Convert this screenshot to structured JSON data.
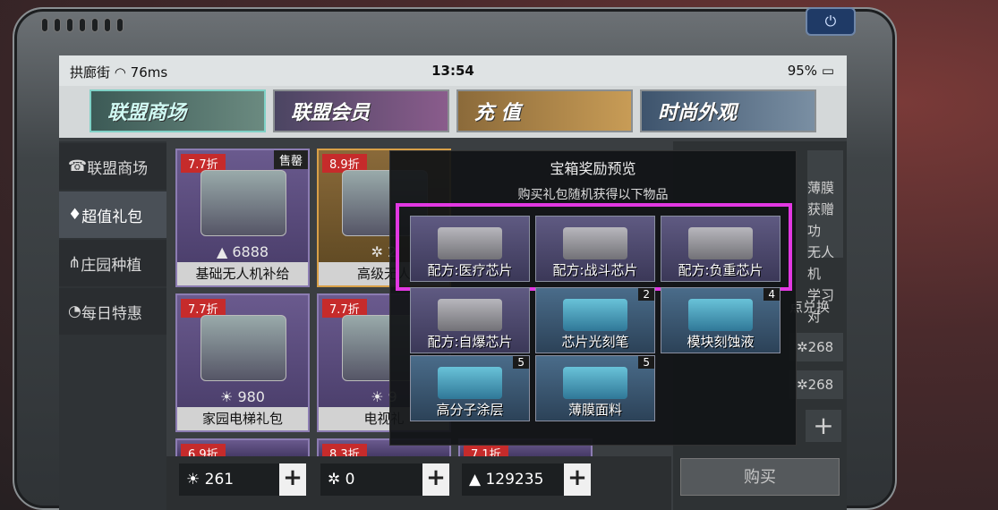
{
  "status": {
    "carrier": "拱廊街",
    "signal": "76ms",
    "time": "13:54",
    "battery": "95%"
  },
  "tabs": [
    "联盟商场",
    "联盟会员",
    "充 值",
    "时尚外观"
  ],
  "sidebar": [
    "联盟商场",
    "超值礼包",
    "庄园种植",
    "每日特惠"
  ],
  "cards": [
    {
      "disc": "7.7折",
      "badge": "售罄",
      "price": "6888",
      "name": "基础无人机补给"
    },
    {
      "disc": "8.9折",
      "badge": "",
      "price": "2",
      "name": "高级无人"
    },
    {
      "disc": "7.7折",
      "badge": "",
      "price": "980",
      "name": "家园电梯礼包"
    },
    {
      "disc": "7.7折",
      "badge": "",
      "price": "9",
      "name": "电视礼"
    },
    {
      "disc": "6.9折"
    },
    {
      "disc": "8.3折"
    },
    {
      "disc": "7.1折"
    }
  ],
  "currency": [
    {
      "value": "261"
    },
    {
      "value": "0"
    },
    {
      "value": "129235"
    }
  ],
  "right": {
    "desc": [
      "薄膜",
      "获赠功",
      "无人机",
      "学习对"
    ],
    "exchange": "点兑换",
    "price1": "268",
    "price2": "268",
    "buy": "购买"
  },
  "modal": {
    "title": "宝箱奖励预览",
    "subtitle": "购买礼包随机获得以下物品",
    "items": [
      {
        "label": "配方:医疗芯片",
        "count": ""
      },
      {
        "label": "配方:战斗芯片",
        "count": ""
      },
      {
        "label": "配方:负重芯片",
        "count": ""
      },
      {
        "label": "配方:自爆芯片",
        "count": ""
      },
      {
        "label": "芯片光刻笔",
        "count": "2"
      },
      {
        "label": "模块刻蚀液",
        "count": "4"
      },
      {
        "label": "高分子涂层",
        "count": "5"
      },
      {
        "label": "薄膜面料",
        "count": "5"
      }
    ]
  }
}
